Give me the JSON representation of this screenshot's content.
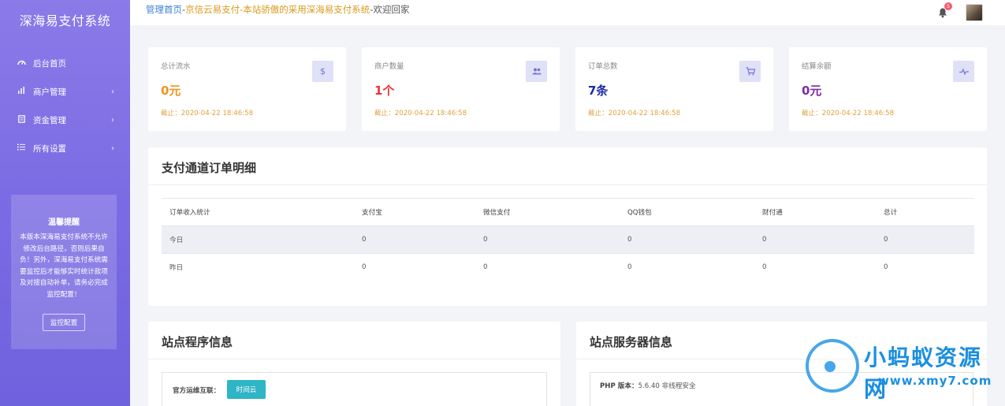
{
  "sidebar": {
    "brand": "深海易支付系统",
    "items": [
      {
        "label": "后台首页",
        "icon": "dashboard-icon",
        "chevron": ""
      },
      {
        "label": "商户管理",
        "icon": "bar-chart-icon",
        "chevron": "›"
      },
      {
        "label": "资金管理",
        "icon": "document-icon",
        "chevron": "›"
      },
      {
        "label": "所有设置",
        "icon": "list-icon",
        "chevron": "›"
      }
    ],
    "tip": {
      "title": "温馨提醒",
      "body": "本版本深海易支付系统不允许修改后台路径，否则后果自负！另外，深海易支付系统需要监控后才能够实时统计款项及对接自动补单，请务必完成监控配置！",
      "button": "监控配置"
    }
  },
  "topbar": {
    "crumb_home": "管理首页",
    "sep1": "-",
    "crumb_site": "京信云易支付",
    "crumb_desc": "-本站骄傲的采用深海易支付系统",
    "crumb_welcome": "-欢迎回家",
    "notification_count": "5"
  },
  "stats": [
    {
      "label": "总计流水",
      "value": "0元",
      "date": "截止：2020-04-22 18:46:58",
      "icon": "dollar-icon",
      "color": "#f0941f"
    },
    {
      "label": "商户数量",
      "value": "1个",
      "date": "截止：2020-04-22 18:46:58",
      "icon": "users-icon",
      "color": "#e8363a"
    },
    {
      "label": "订单总数",
      "value": "7条",
      "date": "截止：2020-04-22 18:46:58",
      "icon": "cart-icon",
      "color": "#1d2aa8"
    },
    {
      "label": "结算余额",
      "value": "0元",
      "date": "截止：2020-04-22 18:46:58",
      "icon": "pulse-icon",
      "color": "#7a2ea3"
    }
  ],
  "orders": {
    "title": "支付通道订单明细",
    "headers": [
      "订单收入统计",
      "支付宝",
      "微信支付",
      "QQ钱包",
      "财付通",
      "总计"
    ],
    "rows": [
      [
        "今日",
        "0",
        "0",
        "0",
        "0",
        "0"
      ],
      [
        "昨日",
        "0",
        "0",
        "0",
        "0",
        "0"
      ]
    ]
  },
  "program": {
    "title": "站点程序信息",
    "label": "官方运维互联：",
    "button": "时间云"
  },
  "server": {
    "title": "站点服务器信息",
    "php_label": "PHP 版本：",
    "php_value": "5.6.40 非线程安全"
  },
  "watermark": {
    "title": "小蚂蚁资源网",
    "url": "www.xmy7.com"
  }
}
